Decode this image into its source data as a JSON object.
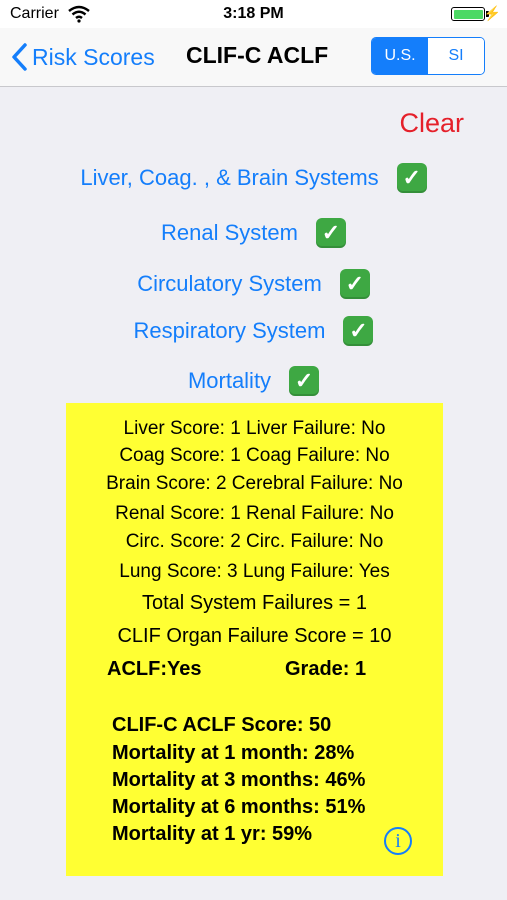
{
  "status_bar": {
    "carrier": "Carrier",
    "time": "3:18 PM"
  },
  "nav": {
    "back_label": "Risk Scores",
    "title": "CLIF-C ACLF",
    "units": [
      "U.S.",
      "SI"
    ],
    "selected_unit": "U.S."
  },
  "clear_label": "Clear",
  "sections": [
    {
      "label": "Liver, Coag. , & Brain Systems",
      "checked": true
    },
    {
      "label": "Renal System",
      "checked": true
    },
    {
      "label": "Circulatory System",
      "checked": true
    },
    {
      "label": "Respiratory System",
      "checked": true
    },
    {
      "label": "Mortality",
      "checked": true
    }
  ],
  "check_glyph": "✓",
  "results": {
    "lines": [
      "Liver Score: 1  Liver Failure: No",
      "Coag Score: 1  Coag Failure: No",
      "Brain Score: 2  Cerebral Failure: No",
      "Renal Score: 1  Renal Failure: No",
      "Circ. Score: 2  Circ. Failure: No",
      "Lung Score: 3  Lung Failure:  Yes"
    ],
    "total_failures": "Total System Failures = 1",
    "organ_failure_score": "CLIF Organ Failure Score = 10",
    "aclf": "ACLF:Yes",
    "grade": "Grade: 1",
    "score": "CLIF-C ACLF Score: 50",
    "mortality": [
      "Mortality at 1 month: 28%",
      "Mortality at 3 months: 46%",
      "Mortality at 6 months: 51%",
      "Mortality at 1 yr: 59%"
    ],
    "info_glyph": "i"
  },
  "colors": {
    "accent": "#147efb",
    "clear": "#e5202a",
    "results_bg": "#ffff33",
    "check_bg": "#3ea843"
  }
}
